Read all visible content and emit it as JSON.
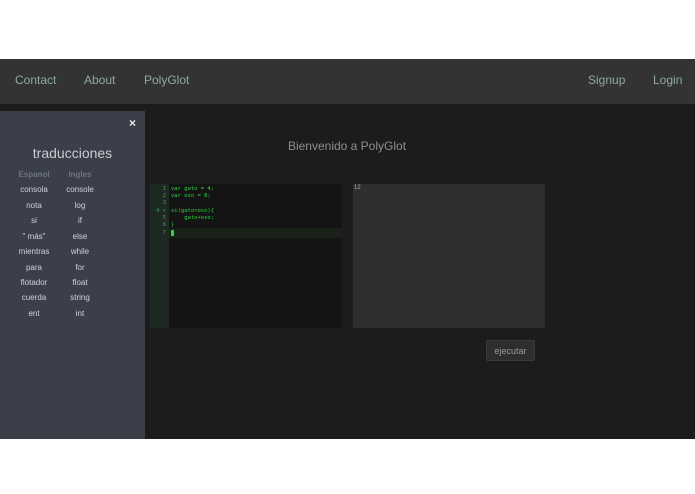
{
  "navbar": {
    "links": {
      "contact": "Contact",
      "about": "About",
      "polyglot": "PolyGlot",
      "signup": "Signup",
      "login": "Login"
    }
  },
  "sidebar": {
    "close_icon": "×",
    "title": "traducciones",
    "headers": {
      "spanish": "Espanol",
      "english": "Ingles"
    },
    "rows": [
      {
        "es": "consola",
        "en": "console"
      },
      {
        "es": "nota",
        "en": "log"
      },
      {
        "es": "si",
        "en": "if"
      },
      {
        "es": "\" más\"",
        "en": "else"
      },
      {
        "es": "mientras",
        "en": "while"
      },
      {
        "es": "para",
        "en": "for"
      },
      {
        "es": "flotador",
        "en": "float"
      },
      {
        "es": "cuerda",
        "en": "string"
      },
      {
        "es": "ent",
        "en": "int"
      }
    ]
  },
  "main": {
    "welcome": "Bienvenido a PolyGlot",
    "editor": {
      "lines": [
        {
          "number": "1",
          "code": "var gato = 4;"
        },
        {
          "number": "2",
          "code": "var oso = 8;"
        },
        {
          "number": "3",
          "code": ""
        },
        {
          "number": "4 ▾",
          "code": "si(gato<oso){"
        },
        {
          "number": "5",
          "code": "    gato+oso;"
        },
        {
          "number": "6",
          "code": "}"
        },
        {
          "number": "7",
          "code": ""
        }
      ]
    },
    "output": {
      "text": "12"
    },
    "run_button": "ejecutar"
  },
  "colors": {
    "navbar": "#333333",
    "sidebar": "#3a3f49",
    "code_green": "#2fd23f",
    "background": "#1c1c1c"
  }
}
